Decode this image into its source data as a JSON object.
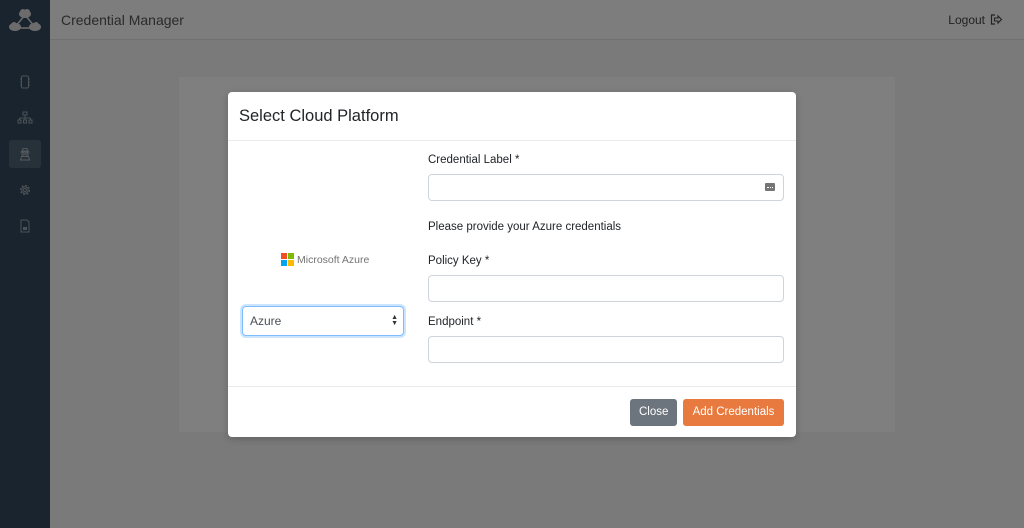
{
  "app": {
    "title": "Credential Manager",
    "logout_label": "Logout"
  },
  "sidebar": {
    "logo": "cloud-network-logo",
    "items": [
      {
        "icon": "chip-icon",
        "active": false
      },
      {
        "icon": "sitemap-icon",
        "active": false
      },
      {
        "icon": "user-secret-icon",
        "active": true
      },
      {
        "icon": "gear-icon",
        "active": false
      },
      {
        "icon": "document-icon",
        "active": false
      }
    ]
  },
  "modal": {
    "title": "Select Cloud Platform",
    "brand_label": "Microsoft Azure",
    "brand_colors": [
      "#f25022",
      "#7fba00",
      "#00a4ef",
      "#ffb900"
    ],
    "platform_select": {
      "selected": "Azure"
    },
    "credential_label": {
      "label": "Credential Label *",
      "value": "",
      "placeholder": ""
    },
    "help_text": "Please provide your Azure credentials",
    "policy_key": {
      "label": "Policy Key *",
      "value": "",
      "placeholder": ""
    },
    "endpoint": {
      "label": "Endpoint *",
      "value": "",
      "placeholder": ""
    },
    "buttons": {
      "close": "Close",
      "add": "Add Credentials"
    }
  },
  "colors": {
    "sidebar_bg": "#33495c",
    "accent_orange": "#e8793f",
    "secondary_gray": "#6c757d",
    "focus_blue": "#80bdff"
  }
}
